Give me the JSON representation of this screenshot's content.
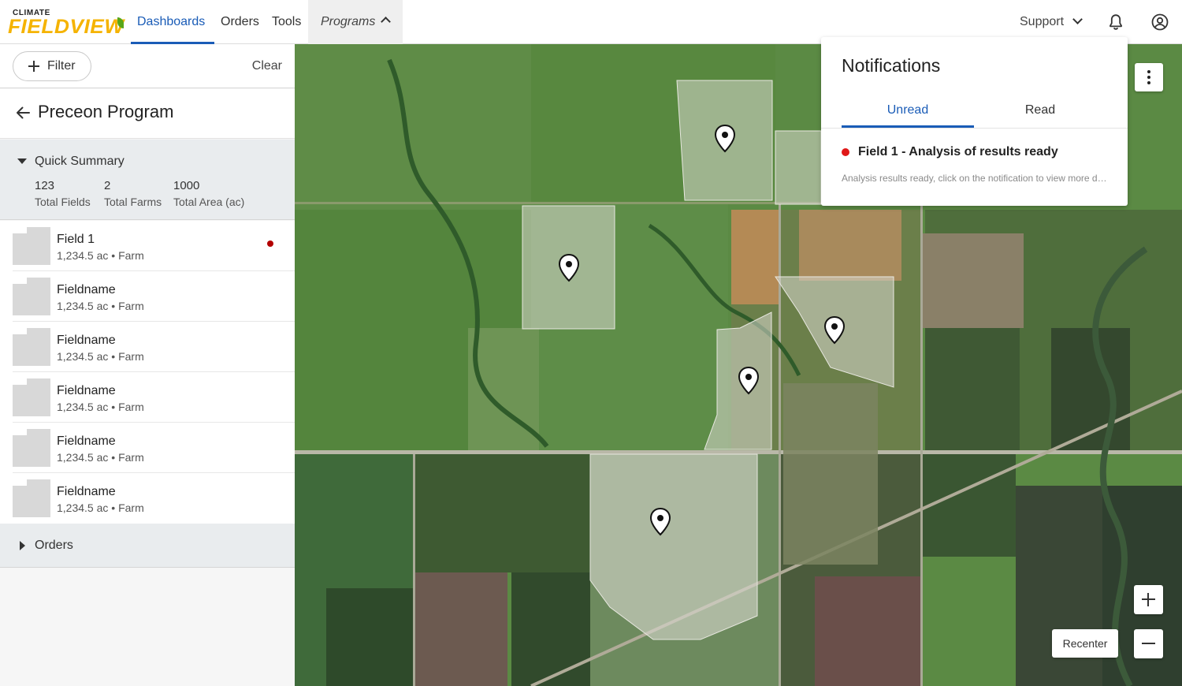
{
  "brand": {
    "top": "CLIMATE",
    "main": "FIELDVIEW"
  },
  "nav": {
    "dashboards": "Dashboards",
    "orders": "Orders",
    "tools": "Tools",
    "programs": "Programs",
    "support": "Support",
    "icons": {
      "notifications": "bell-icon",
      "account": "account-circle-icon"
    }
  },
  "sidebar": {
    "filter_label": "Filter",
    "clear_label": "Clear",
    "program_title": "Preceon Program",
    "summary": {
      "title": "Quick Summary",
      "stats": [
        {
          "value": "123",
          "label": "Total Fields"
        },
        {
          "value": "2",
          "label": "Total Farms"
        },
        {
          "value": "1000",
          "label": "Total Area (ac)"
        }
      ]
    },
    "fields": [
      {
        "name": "Field 1",
        "meta": "1,234.5 ac • Farm",
        "unread": true
      },
      {
        "name": "Fieldname",
        "meta": "1,234.5 ac • Farm",
        "unread": false
      },
      {
        "name": "Fieldname",
        "meta": "1,234.5 ac • Farm",
        "unread": false
      },
      {
        "name": "Fieldname",
        "meta": "1,234.5 ac • Farm",
        "unread": false
      },
      {
        "name": "Fieldname",
        "meta": "1,234.5 ac • Farm",
        "unread": false
      },
      {
        "name": "Fieldname",
        "meta": "1,234.5 ac • Farm",
        "unread": false
      }
    ],
    "orders_label": "Orders"
  },
  "notifications": {
    "title": "Notifications",
    "tabs": [
      "Unread",
      "Read"
    ],
    "active_tab": "Unread",
    "items": [
      {
        "title": "Field 1 - Analysis of results ready",
        "description": "Analysis results ready, click on the notification to view more details",
        "status_color": "#e01818"
      }
    ]
  },
  "map": {
    "recenter_label": "Recenter",
    "map_pin_count": 6
  },
  "colors": {
    "accent": "#1a5cb7",
    "brand_yellow": "#f5b300",
    "unread_dot": "#b30000"
  }
}
